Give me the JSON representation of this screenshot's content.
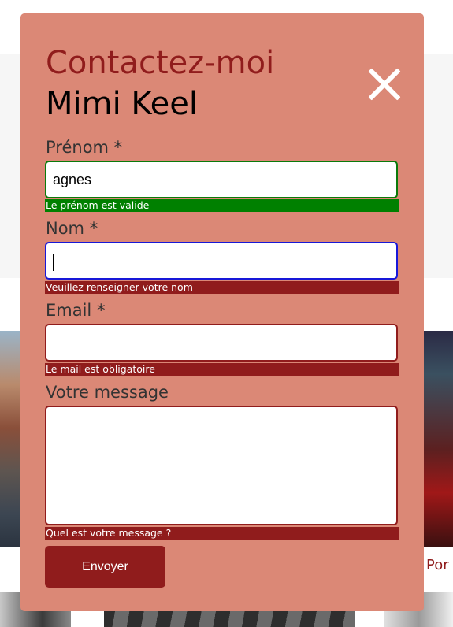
{
  "background": {
    "caption": "Por"
  },
  "modal": {
    "title": "Contactez-moi",
    "photographer_name": "Mimi Keel",
    "fields": [
      {
        "label": "Prénom *",
        "value": "agnes",
        "message": "Le prénom est valide",
        "state": "valid"
      },
      {
        "label": "Nom *",
        "value": "",
        "message": "Veuillez renseigner votre nom",
        "state": "error-focused"
      },
      {
        "label": "Email *",
        "value": "",
        "message": "Le mail est obligatoire",
        "state": "error"
      },
      {
        "label": "Votre message",
        "value": "",
        "message": "Quel est votre message ?",
        "state": "error"
      }
    ],
    "submit_label": "Envoyer"
  },
  "colors": {
    "modal_bg": "#db8876",
    "accent": "#901c1c",
    "valid": "#008000",
    "focus": "#1818d8"
  }
}
